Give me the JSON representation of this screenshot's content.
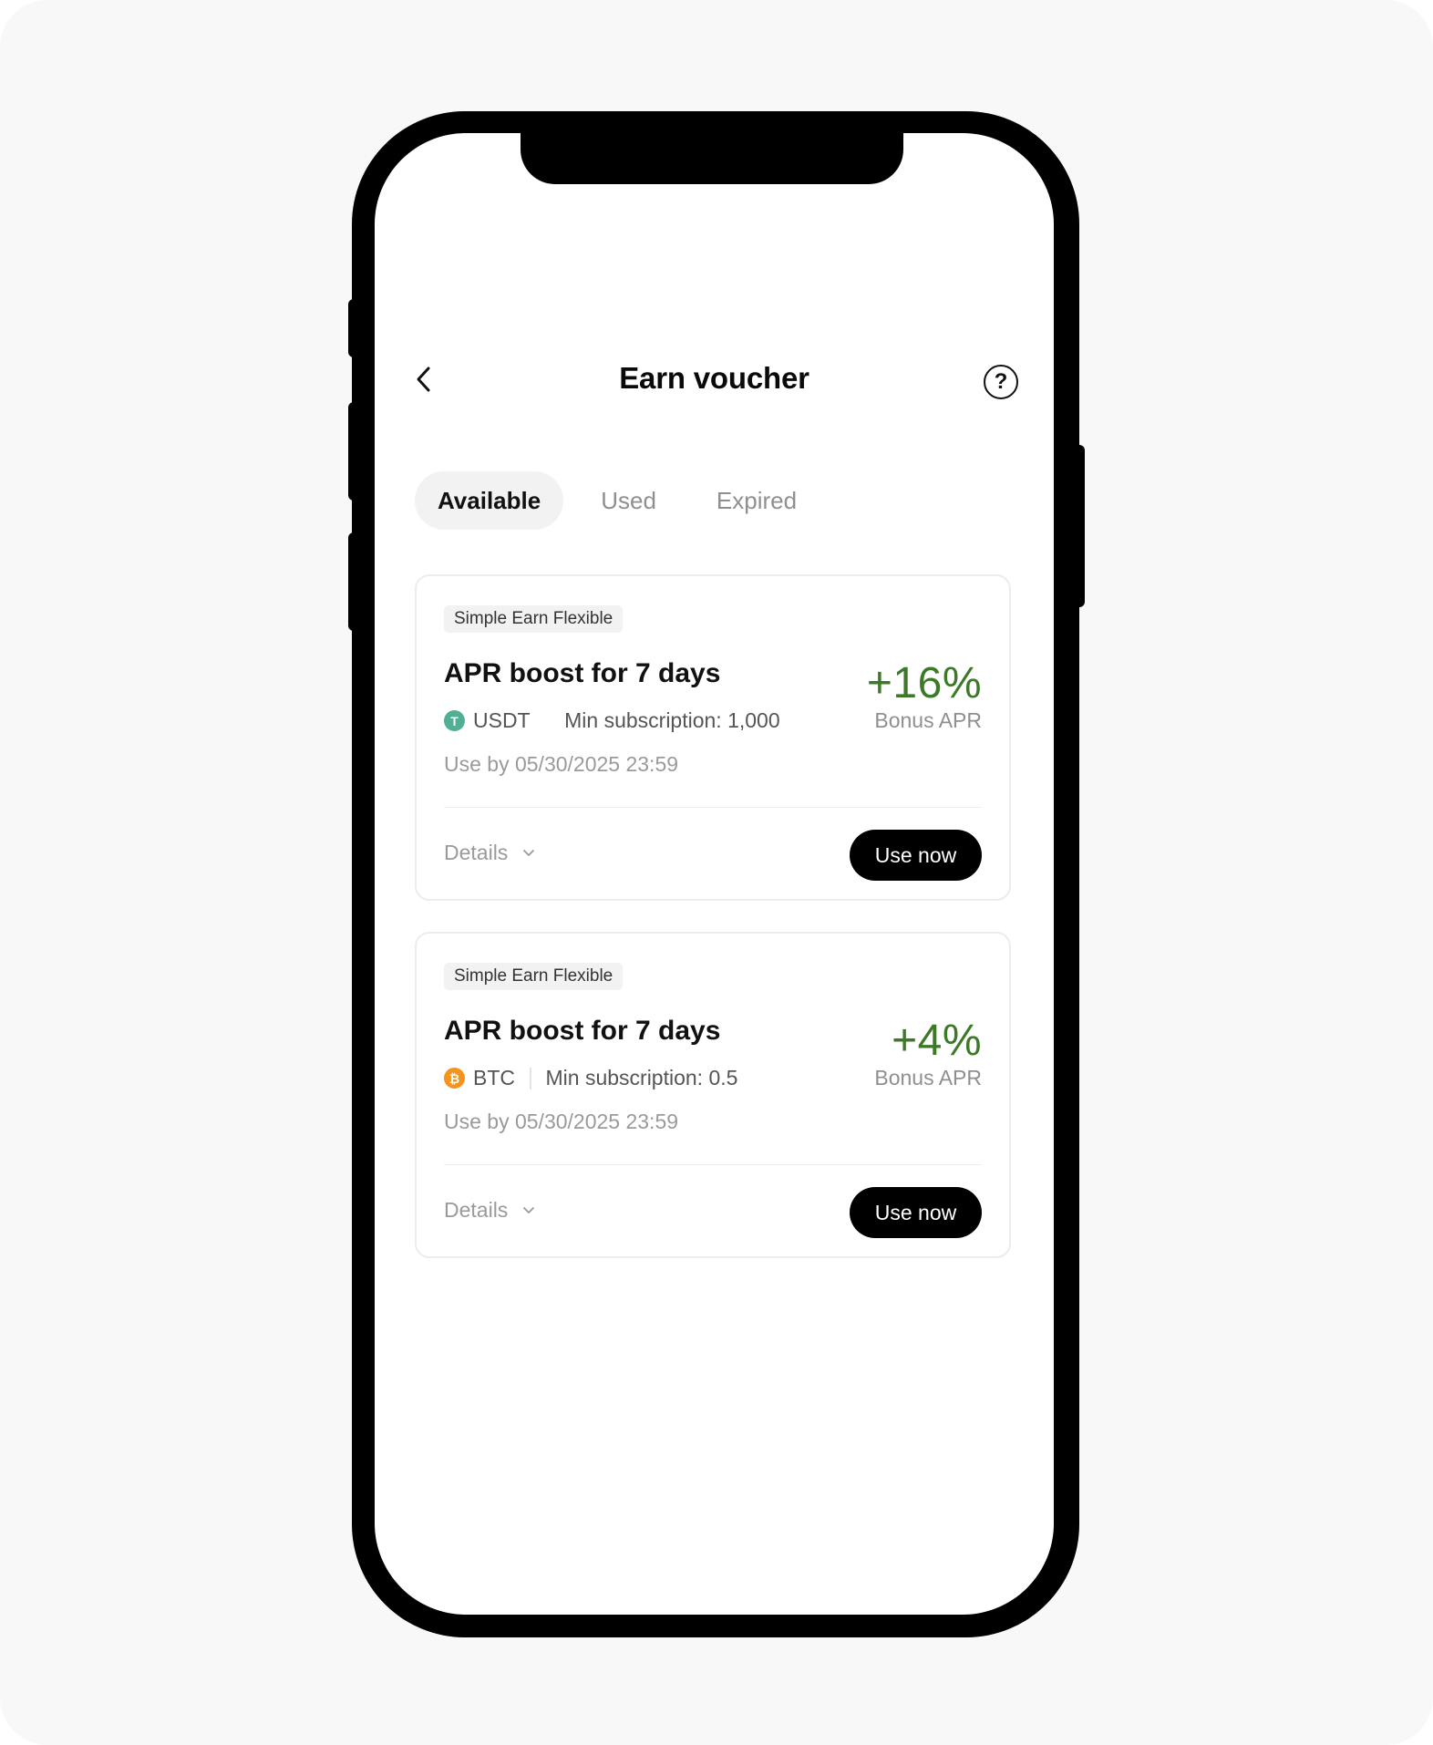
{
  "header": {
    "title": "Earn voucher",
    "help_symbol": "?"
  },
  "tabs": [
    {
      "label": "Available",
      "active": true
    },
    {
      "label": "Used",
      "active": false
    },
    {
      "label": "Expired",
      "active": false
    }
  ],
  "vouchers": [
    {
      "tag": "Simple Earn Flexible",
      "title": "APR boost for 7 days",
      "coin": "USDT",
      "coin_symbol": "T",
      "coin_icon": "usdt-coin-icon",
      "min_subscription": "Min subscription: 1,000",
      "use_by": "Use by 05/30/2025 23:59",
      "bonus_value": "+16%",
      "bonus_label": "Bonus APR",
      "details_label": "Details",
      "action_label": "Use now"
    },
    {
      "tag": "Simple Earn Flexible",
      "title": "APR boost for 7 days",
      "coin": "BTC",
      "coin_symbol": "₿",
      "coin_icon": "btc-coin-icon",
      "min_subscription": "Min subscription: 0.5",
      "use_by": "Use by 05/30/2025 23:59",
      "bonus_value": "+4%",
      "bonus_label": "Bonus APR",
      "details_label": "Details",
      "action_label": "Use now"
    }
  ],
  "colors": {
    "bonus_green": "#3c7a28",
    "usdt_green": "#50af95",
    "btc_orange": "#f7931a",
    "primary_button": "#000000"
  }
}
